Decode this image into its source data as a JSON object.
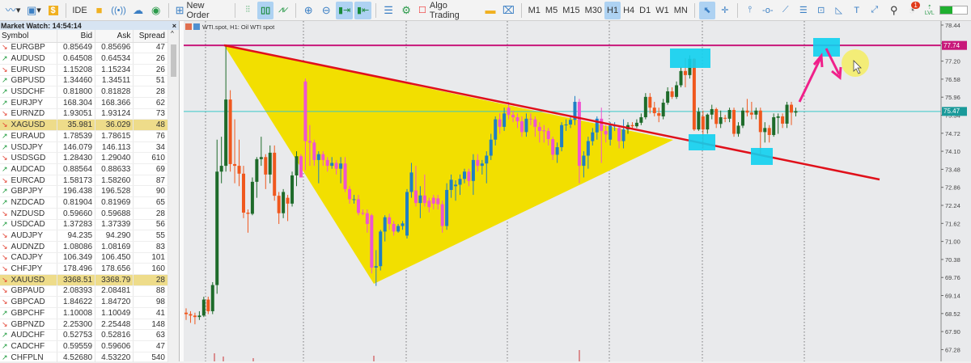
{
  "toolbar": {
    "ide": "IDE",
    "new_order": "New Order",
    "algo_trading": "Algo Trading",
    "timeframes": [
      "M1",
      "M5",
      "M15",
      "M30",
      "H1",
      "H4",
      "D1",
      "W1",
      "MN"
    ],
    "selected_timeframe": "H1",
    "notification_count": "1",
    "lvl": "LVL"
  },
  "market_watch": {
    "title": "Market Watch: 14:54:14",
    "columns": [
      "Symbol",
      "Bid",
      "Ask",
      "Spread"
    ],
    "rows": [
      [
        "EURGBP",
        "0.85649",
        "0.85696",
        "47",
        "down"
      ],
      [
        "AUDUSD",
        "0.64508",
        "0.64534",
        "26",
        "up"
      ],
      [
        "EURUSD",
        "1.15208",
        "1.15234",
        "26",
        "down"
      ],
      [
        "GBPUSD",
        "1.34460",
        "1.34511",
        "51",
        "up"
      ],
      [
        "USDCHF",
        "0.81800",
        "0.81828",
        "28",
        "up"
      ],
      [
        "EURJPY",
        "168.304",
        "168.366",
        "62",
        "up"
      ],
      [
        "EURNZD",
        "1.93051",
        "1.93124",
        "73",
        "down"
      ],
      [
        "XAGUSD",
        "35.981",
        "36.029",
        "48",
        "down"
      ],
      [
        "EURAUD",
        "1.78539",
        "1.78615",
        "76",
        "up"
      ],
      [
        "USDJPY",
        "146.079",
        "146.113",
        "34",
        "up"
      ],
      [
        "USDSGD",
        "1.28430",
        "1.29040",
        "610",
        "down"
      ],
      [
        "AUDCAD",
        "0.88564",
        "0.88633",
        "69",
        "up"
      ],
      [
        "EURCAD",
        "1.58173",
        "1.58260",
        "87",
        "down"
      ],
      [
        "GBPJPY",
        "196.438",
        "196.528",
        "90",
        "up"
      ],
      [
        "NZDCAD",
        "0.81904",
        "0.81969",
        "65",
        "up"
      ],
      [
        "NZDUSD",
        "0.59660",
        "0.59688",
        "28",
        "down"
      ],
      [
        "USDCAD",
        "1.37283",
        "1.37339",
        "56",
        "up"
      ],
      [
        "AUDJPY",
        "94.235",
        "94.290",
        "55",
        "down"
      ],
      [
        "AUDNZD",
        "1.08086",
        "1.08169",
        "83",
        "down"
      ],
      [
        "CADJPY",
        "106.349",
        "106.450",
        "101",
        "down"
      ],
      [
        "CHFJPY",
        "178.496",
        "178.656",
        "160",
        "down"
      ],
      [
        "XAUUSD",
        "3368.51",
        "3368.79",
        "28",
        "down"
      ],
      [
        "GBPAUD",
        "2.08393",
        "2.08481",
        "88",
        "down"
      ],
      [
        "GBPCAD",
        "1.84622",
        "1.84720",
        "98",
        "down"
      ],
      [
        "GBPCHF",
        "1.10008",
        "1.10049",
        "41",
        "up"
      ],
      [
        "GBPNZD",
        "2.25300",
        "2.25448",
        "148",
        "down"
      ],
      [
        "AUDCHF",
        "0.52753",
        "0.52816",
        "63",
        "up"
      ],
      [
        "CADCHF",
        "0.59559",
        "0.59606",
        "47",
        "up"
      ],
      [
        "CHFPLN",
        "4.52680",
        "4.53220",
        "540",
        "up"
      ]
    ],
    "highlighted": [
      "XAGUSD",
      "XAUUSD"
    ]
  },
  "chart": {
    "title": "WTI.spot, H1:  Oil WTI spot",
    "resistance_label": "77.74",
    "current_label": "75.47"
  },
  "chart_data": {
    "type": "candlestick",
    "symbol": "WTI.spot",
    "timeframe": "H1",
    "ylim": [
      66.9,
      78.6
    ],
    "y_ticks": [
      "78.44",
      "77.82",
      "77.20",
      "76.58",
      "75.96",
      "75.34",
      "74.72",
      "74.10",
      "73.48",
      "72.86",
      "72.24",
      "71.62",
      "71.00",
      "70.38",
      "69.76",
      "69.14",
      "68.52",
      "67.90",
      "67.28"
    ],
    "resistance": 77.74,
    "current_price": 75.47,
    "highlight_range": [
      26,
      99
    ],
    "colors": {
      "bull": "#1e6b2a",
      "bear": "#f0581e",
      "bull_hl": "#1f7fc4",
      "bear_hl": "#ee55d0",
      "resistance": "#c8187a",
      "current": "#3ac8c8",
      "trend": "#e0101a",
      "pattern": "#f2df00",
      "box": "#10d0f0",
      "arrow": "#f0208a"
    },
    "ohlc": [
      [
        68.55,
        68.7,
        68.3,
        68.5
      ],
      [
        68.5,
        68.6,
        68.2,
        68.45
      ],
      [
        68.45,
        68.55,
        68.15,
        68.4
      ],
      [
        68.4,
        68.6,
        68.3,
        68.45
      ],
      [
        68.45,
        69.1,
        68.4,
        69.0
      ],
      [
        69.0,
        69.1,
        68.5,
        68.6
      ],
      [
        68.6,
        69.6,
        68.5,
        69.5
      ],
      [
        69.5,
        74.5,
        69.2,
        73.4
      ],
      [
        73.4,
        74.6,
        73.0,
        73.6
      ],
      [
        73.6,
        77.77,
        73.4,
        75.88
      ],
      [
        75.88,
        76.2,
        73.4,
        73.66
      ],
      [
        73.66,
        75.2,
        73.0,
        73.6
      ],
      [
        73.6,
        74.5,
        72.9,
        73.33
      ],
      [
        73.33,
        73.6,
        71.8,
        71.99
      ],
      [
        71.99,
        72.1,
        71.3,
        71.95
      ],
      [
        71.95,
        73.2,
        71.9,
        73.05
      ],
      [
        73.05,
        73.9,
        72.5,
        73.83
      ],
      [
        73.83,
        74.6,
        73.6,
        73.9
      ],
      [
        73.9,
        74.0,
        72.8,
        73.3
      ],
      [
        73.3,
        74.3,
        73.0,
        74.05
      ],
      [
        74.05,
        74.3,
        72.4,
        72.57
      ],
      [
        72.57,
        72.7,
        71.6,
        71.97
      ],
      [
        71.97,
        72.8,
        71.8,
        72.7
      ],
      [
        72.5,
        72.6,
        71.7,
        72.3
      ],
      [
        72.3,
        73.4,
        72.2,
        73.27
      ],
      [
        73.27,
        74.1,
        72.9,
        73.93
      ],
      [
        73.93,
        74.0,
        73.3,
        73.2
      ],
      [
        76.5,
        76.6,
        73.45,
        74.45
      ],
      [
        74.45,
        75.0,
        73.6,
        74.4
      ],
      [
        74.4,
        74.5,
        73.6,
        73.8
      ],
      [
        73.8,
        74.1,
        73.0,
        74.0
      ],
      [
        74.0,
        74.1,
        73.6,
        73.8
      ],
      [
        73.8,
        73.9,
        73.4,
        73.6
      ],
      [
        73.6,
        73.9,
        73.5,
        73.7
      ],
      [
        73.7,
        73.8,
        73.3,
        73.5
      ],
      [
        73.5,
        73.9,
        73.0,
        73.68
      ],
      [
        73.68,
        73.9,
        72.7,
        72.8
      ],
      [
        72.8,
        72.9,
        72.3,
        72.45
      ],
      [
        72.45,
        72.6,
        72.3,
        72.45
      ],
      [
        72.45,
        72.6,
        71.9,
        71.98
      ],
      [
        71.98,
        72.1,
        71.9,
        71.97
      ],
      [
        71.97,
        72.1,
        71.3,
        71.6
      ],
      [
        71.9,
        71.95,
        69.9,
        70.1
      ],
      [
        70.1,
        70.7,
        69.47,
        70.15
      ],
      [
        70.15,
        71.4,
        70.0,
        71.34
      ],
      [
        71.34,
        71.9,
        71.0,
        71.83
      ],
      [
        71.83,
        71.95,
        71.4,
        71.6
      ],
      [
        71.6,
        71.7,
        71.2,
        71.34
      ],
      [
        71.34,
        71.6,
        71.3,
        71.53
      ],
      [
        71.53,
        71.7,
        71.4,
        71.62
      ],
      [
        71.2,
        72.8,
        71.1,
        72.7
      ],
      [
        72.7,
        73.7,
        72.5,
        73.37
      ],
      [
        72.75,
        73.6,
        72.2,
        72.32
      ],
      [
        72.32,
        72.9,
        71.8,
        72.58
      ],
      [
        72.58,
        73.3,
        72.2,
        72.32
      ],
      [
        72.4,
        72.5,
        72.0,
        72.18
      ],
      [
        72.5,
        72.6,
        72.1,
        72.3
      ],
      [
        72.48,
        72.6,
        72.1,
        72.28
      ],
      [
        72.28,
        72.4,
        71.3,
        71.53
      ],
      [
        71.53,
        73.0,
        71.4,
        72.77
      ],
      [
        72.77,
        73.3,
        72.5,
        73.12
      ],
      [
        72.9,
        73.1,
        72.4,
        72.95
      ],
      [
        72.95,
        73.3,
        72.6,
        73.15
      ],
      [
        73.15,
        73.5,
        73.0,
        73.4
      ],
      [
        73.4,
        73.5,
        72.9,
        73.08
      ],
      [
        73.08,
        74.0,
        72.6,
        73.8
      ],
      [
        73.8,
        74.0,
        73.4,
        73.6
      ],
      [
        73.6,
        73.8,
        73.3,
        73.68
      ],
      [
        73.68,
        74.1,
        73.0,
        73.95
      ],
      [
        73.95,
        74.7,
        73.8,
        74.5
      ],
      [
        74.5,
        75.3,
        74.3,
        75.2
      ],
      [
        75.2,
        75.4,
        74.7,
        74.94
      ],
      [
        74.94,
        75.6,
        74.8,
        75.4
      ],
      [
        75.6,
        75.8,
        75.2,
        75.35
      ],
      [
        75.35,
        75.5,
        75.1,
        75.27
      ],
      [
        75.27,
        75.4,
        74.9,
        75.13
      ],
      [
        75.13,
        75.3,
        74.6,
        74.76
      ],
      [
        74.76,
        75.4,
        74.6,
        75.22
      ],
      [
        75.22,
        75.4,
        75.0,
        75.2
      ],
      [
        75.2,
        75.3,
        74.6,
        74.94
      ],
      [
        74.94,
        75.1,
        74.4,
        74.8
      ],
      [
        74.82,
        75.0,
        74.4,
        74.8
      ],
      [
        74.8,
        74.9,
        74.3,
        74.52
      ],
      [
        74.52,
        74.6,
        73.8,
        73.98
      ],
      [
        73.98,
        74.4,
        73.7,
        74.24
      ],
      [
        74.24,
        75.1,
        74.1,
        75.0
      ],
      [
        75.0,
        75.2,
        74.8,
        75.02
      ],
      [
        75.02,
        75.3,
        74.9,
        75.18
      ],
      [
        75.18,
        76.0,
        75.0,
        75.8
      ],
      [
        75.8,
        75.9,
        73.0,
        73.6
      ],
      [
        73.6,
        74.1,
        73.2,
        73.95
      ],
      [
        73.95,
        74.6,
        73.5,
        74.45
      ],
      [
        74.45,
        74.9,
        74.3,
        74.75
      ],
      [
        74.75,
        75.3,
        74.5,
        75.22
      ],
      [
        75.22,
        75.6,
        73.7,
        74.8
      ],
      [
        74.8,
        75.0,
        74.4,
        74.68
      ],
      [
        74.5,
        75.1,
        74.3,
        74.98
      ],
      [
        74.98,
        75.1,
        74.8,
        74.98
      ],
      [
        74.9,
        75.0,
        74.2,
        74.45
      ],
      [
        74.45,
        75.2,
        74.2,
        74.85
      ],
      [
        74.85,
        75.1,
        74.7,
        75.0
      ],
      [
        75.0,
        75.1,
        74.9,
        74.96
      ],
      [
        74.96,
        75.2,
        74.9,
        75.08
      ],
      [
        75.08,
        75.4,
        75.0,
        75.27
      ],
      [
        75.27,
        76.1,
        75.2,
        75.97
      ],
      [
        75.97,
        76.1,
        75.4,
        75.6
      ],
      [
        75.6,
        75.8,
        75.3,
        75.41
      ],
      [
        75.41,
        75.6,
        75.1,
        75.32
      ],
      [
        75.3,
        75.9,
        75.2,
        75.77
      ],
      [
        75.77,
        76.3,
        75.7,
        76.16
      ],
      [
        76.16,
        76.3,
        75.9,
        75.97
      ],
      [
        75.97,
        76.5,
        75.9,
        76.37
      ],
      [
        76.37,
        77.0,
        76.3,
        76.86
      ],
      [
        76.86,
        77.3,
        76.3,
        76.72
      ],
      [
        76.72,
        77.4,
        76.6,
        77.28
      ],
      [
        77.28,
        77.3,
        74.8,
        74.85
      ],
      [
        74.85,
        75.6,
        74.8,
        75.46
      ],
      [
        75.3,
        75.5,
        74.2,
        74.85
      ],
      [
        74.85,
        75.4,
        74.7,
        75.36
      ],
      [
        75.36,
        75.7,
        75.2,
        75.55
      ],
      [
        75.55,
        75.6,
        74.9,
        75.04
      ],
      [
        75.04,
        75.5,
        74.9,
        75.27
      ],
      [
        75.25,
        75.35,
        75.1,
        75.22
      ],
      [
        75.22,
        75.6,
        75.1,
        75.52
      ],
      [
        75.52,
        75.6,
        74.6,
        74.7
      ],
      [
        74.7,
        75.1,
        74.6,
        74.98
      ],
      [
        74.98,
        75.6,
        74.9,
        75.5
      ],
      [
        75.5,
        75.9,
        75.3,
        75.43
      ],
      [
        75.43,
        75.8,
        75.2,
        75.36
      ],
      [
        75.36,
        75.6,
        75.2,
        75.5
      ],
      [
        75.5,
        75.6,
        74.0,
        74.76
      ],
      [
        74.76,
        75.1,
        74.4,
        74.9
      ],
      [
        74.9,
        75.0,
        74.4,
        74.66
      ],
      [
        74.66,
        75.4,
        74.6,
        75.27
      ],
      [
        75.25,
        75.4,
        74.7,
        75.3
      ],
      [
        75.3,
        75.4,
        74.9,
        75.05
      ],
      [
        75.05,
        75.8,
        74.9,
        75.7
      ],
      [
        75.7,
        75.8,
        75.0,
        75.43
      ],
      [
        75.43,
        75.6,
        75.3,
        75.48
      ]
    ]
  }
}
